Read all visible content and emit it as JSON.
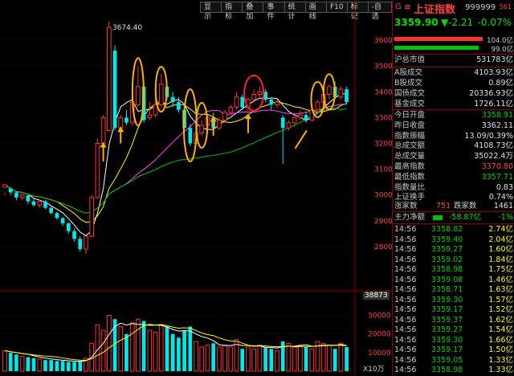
{
  "toolbar": {
    "items": [
      "显示",
      "指标",
      "叠加",
      "事件",
      "统计",
      "画线",
      "F10",
      "标记",
      "-自选"
    ]
  },
  "chart": {
    "price_axis": [
      "3600",
      "3500",
      "3400",
      "3300",
      "3200",
      "3100",
      "3000",
      "2900",
      "2800"
    ],
    "volume_axis": [
      "38873",
      "30000",
      "20000",
      "10000"
    ],
    "volume_unit": "X10万",
    "peak_label": "3674.40"
  },
  "chart_data": {
    "type": "candlestick",
    "ylim": [
      2650,
      3700
    ],
    "peak": 3674.4,
    "candles": [
      [
        3030,
        3040,
        3010,
        3000
      ],
      [
        3025,
        3010,
        3030,
        3000
      ],
      [
        3010,
        2990,
        3015,
        2980
      ],
      [
        2990,
        3000,
        3005,
        2980
      ],
      [
        2998,
        2975,
        3000,
        2965
      ],
      [
        2975,
        2960,
        2985,
        2955
      ],
      [
        2960,
        2975,
        2980,
        2950
      ],
      [
        2975,
        2950,
        2980,
        2945
      ],
      [
        2950,
        2930,
        2955,
        2925
      ],
      [
        2930,
        2910,
        2935,
        2905
      ],
      [
        2910,
        2890,
        2915,
        2880
      ],
      [
        2890,
        2860,
        2895,
        2850
      ],
      [
        2860,
        2830,
        2870,
        2820
      ],
      [
        2830,
        2790,
        2840,
        2780
      ],
      [
        2790,
        2840,
        2795,
        2770
      ],
      [
        2840,
        2990,
        3000,
        2835
      ],
      [
        2990,
        3200,
        3220,
        2985
      ],
      [
        3200,
        3300,
        3310,
        3190
      ],
      [
        3250,
        3650,
        3674.4,
        3245
      ],
      [
        3560,
        3260,
        3580,
        3250
      ],
      [
        3260,
        3300,
        3310,
        3200
      ],
      [
        3300,
        3280,
        3330,
        3270
      ],
      [
        3280,
        3360,
        3380,
        3270
      ],
      [
        3350,
        3420,
        3500,
        3340
      ],
      [
        3420,
        3290,
        3440,
        3280
      ],
      [
        3300,
        3310,
        3360,
        3290
      ],
      [
        3310,
        3350,
        3390,
        3300
      ],
      [
        3350,
        3430,
        3470,
        3340
      ],
      [
        3420,
        3380,
        3440,
        3370
      ],
      [
        3380,
        3360,
        3400,
        3340
      ],
      [
        3360,
        3330,
        3380,
        3320
      ],
      [
        3330,
        3260,
        3345,
        3240
      ],
      [
        3260,
        3200,
        3275,
        3190
      ],
      [
        3200,
        3240,
        3255,
        3195
      ],
      [
        3240,
        3270,
        3290,
        3230
      ],
      [
        3270,
        3300,
        3310,
        3260
      ],
      [
        3300,
        3260,
        3320,
        3250
      ],
      [
        3260,
        3290,
        3300,
        3250
      ],
      [
        3290,
        3320,
        3330,
        3280
      ],
      [
        3320,
        3340,
        3350,
        3310
      ],
      [
        3340,
        3380,
        3400,
        3330
      ],
      [
        3380,
        3340,
        3390,
        3330
      ],
      [
        3340,
        3370,
        3380,
        3330
      ],
      [
        3370,
        3390,
        3410,
        3360
      ],
      [
        3390,
        3400,
        3420,
        3380
      ],
      [
        3400,
        3370,
        3410,
        3360
      ],
      [
        3370,
        3350,
        3380,
        3330
      ],
      [
        3350,
        3360,
        3370,
        3340
      ],
      [
        3300,
        3260,
        3310,
        3120
      ],
      [
        3260,
        3280,
        3290,
        3250
      ],
      [
        3280,
        3300,
        3310,
        3270
      ],
      [
        3300,
        3310,
        3330,
        3290
      ],
      [
        3310,
        3290,
        3320,
        3280
      ],
      [
        3290,
        3330,
        3340,
        3285
      ],
      [
        3330,
        3360,
        3370,
        3320
      ],
      [
        3360,
        3390,
        3400,
        3350
      ],
      [
        3390,
        3420,
        3430,
        3370
      ],
      [
        3420,
        3380,
        3440,
        3370
      ],
      [
        3380,
        3410,
        3420,
        3370
      ],
      [
        3410,
        3360,
        3420,
        3350
      ]
    ],
    "volumes": [
      11000,
      10000,
      9000,
      8000,
      7500,
      7000,
      6500,
      6000,
      6000,
      5500,
      5500,
      5000,
      5000,
      5500,
      7000,
      15000,
      25000,
      22000,
      30000,
      28000,
      24000,
      20000,
      26000,
      28000,
      27000,
      22000,
      21000,
      25000,
      24000,
      20000,
      18000,
      22000,
      24000,
      16000,
      13000,
      14000,
      15000,
      13000,
      14000,
      13000,
      17000,
      12000,
      13000,
      12000,
      14000,
      13000,
      12000,
      11000,
      16000,
      15000,
      13000,
      14000,
      13000,
      12000,
      16000,
      15000,
      14000,
      12000,
      15000,
      13000
    ]
  },
  "panel": {
    "header": {
      "marker": "G",
      "flag": "≡",
      "name": "上证指数",
      "code": "999999",
      "tag": "S61"
    },
    "quote": {
      "price": "3359.90",
      "change": "▼-2.21",
      "pct": "-0.07%"
    },
    "bars": {
      "top": "104.0亿",
      "bottom": "99.0亿"
    },
    "market_cap": {
      "label": "沪总市值",
      "value": "531783亿"
    },
    "turnover": [
      {
        "label": "A股成交",
        "value": "4103.93亿"
      },
      {
        "label": "B股成交",
        "value": "0.89亿"
      },
      {
        "label": "国债成交",
        "value": "20336.93亿"
      },
      {
        "label": "基金成交",
        "value": "1726.11亿"
      }
    ],
    "stats": [
      {
        "label": "今日开盘",
        "value": "3358.91",
        "color": "green"
      },
      {
        "label": "昨日收盘",
        "value": "3362.11",
        "color": "white"
      },
      {
        "label": "指数振幅",
        "value": "13.09/0.39%",
        "color": "white"
      },
      {
        "label": "总成交额",
        "value": "4108.73亿",
        "color": "white"
      },
      {
        "label": "总成交量",
        "value": "35022.4万",
        "color": "white"
      },
      {
        "label": "最高指数",
        "value": "3370.80",
        "color": "red"
      },
      {
        "label": "最低指数",
        "value": "3357.71",
        "color": "green"
      },
      {
        "label": "指数量比",
        "value": "0.83",
        "color": "white"
      },
      {
        "label": "上证换手",
        "value": "0.74%",
        "color": "white"
      }
    ],
    "breadth": {
      "up_label": "涨家数",
      "up": "751",
      "down_label": "跌家数",
      "down": "1461"
    },
    "netflow": {
      "label": "主力净额",
      "value": "-58.87亿",
      "pct": "-1%"
    },
    "ticks": [
      {
        "t": "14:56",
        "p": "3358.82",
        "q": "2.74亿"
      },
      {
        "t": "14:56",
        "p": "3359.40",
        "q": "2.04亿"
      },
      {
        "t": "14:56",
        "p": "3359.27",
        "q": "1.60亿"
      },
      {
        "t": "14:56",
        "p": "3359.02",
        "q": "1.84亿"
      },
      {
        "t": "14:56",
        "p": "3358.98",
        "q": "1.75亿"
      },
      {
        "t": "14:56",
        "p": "3359.08",
        "q": "1.46亿"
      },
      {
        "t": "14:56",
        "p": "3358.71",
        "q": "1.63亿"
      },
      {
        "t": "14:56",
        "p": "3359.30",
        "q": "1.57亿"
      },
      {
        "t": "14:56",
        "p": "3359.17",
        "q": "1.52亿"
      },
      {
        "t": "14:56",
        "p": "3359.37",
        "q": "1.62亿"
      },
      {
        "t": "14:56",
        "p": "3359.27",
        "q": "1.54亿"
      },
      {
        "t": "14:56",
        "p": "3359.30",
        "q": "1.66亿"
      },
      {
        "t": "14:56",
        "p": "3359.17",
        "q": "1.50亿"
      },
      {
        "t": "14:56",
        "p": "3359.05",
        "q": "1.33亿"
      },
      {
        "t": "14:56",
        "p": "3358.98",
        "q": "1.33亿"
      }
    ],
    "colors": {
      "up": "#ff3030",
      "down": "#00e8e8",
      "ma5": "#ffffff",
      "ma10": "#ffff00",
      "ma20": "#ff40ff",
      "ma60": "#00c000",
      "annotation_circle": "#ffb000",
      "annotation_red": "#ff2020",
      "arrow": "#ffb000"
    }
  }
}
